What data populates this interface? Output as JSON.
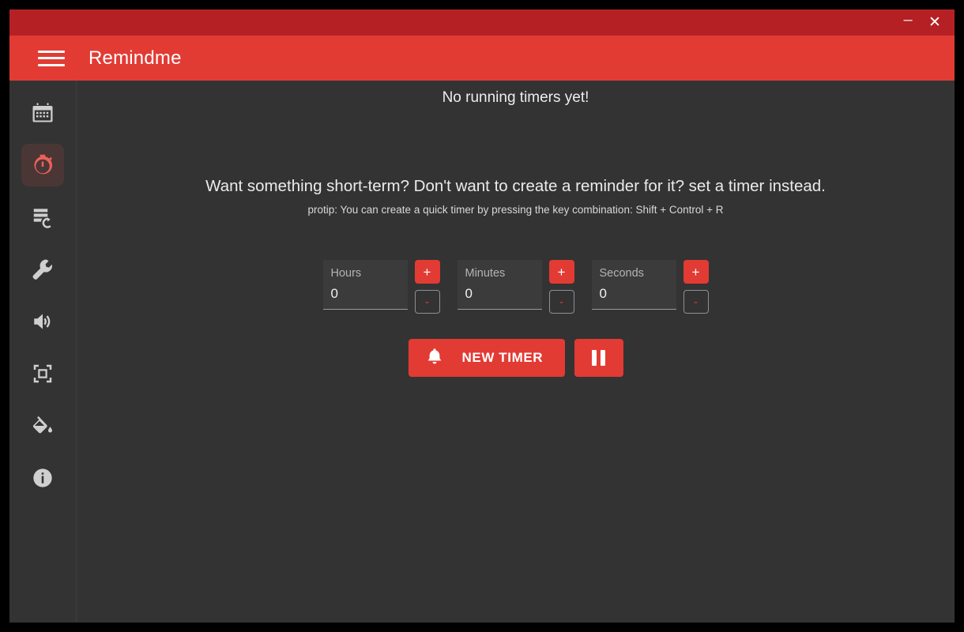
{
  "window": {
    "titlebar": {
      "minimize_label": "–",
      "close_label": "✕"
    },
    "header": {
      "title": "Remindme",
      "menu_icon": "hamburger-icon"
    },
    "colors": {
      "titlebar_red": "#b52025",
      "header_red": "#e23b34",
      "accent_red": "#e23b34",
      "active_icon_red": "#ec6158",
      "background_dark": "#333333",
      "active_item_bg": "#4b3636"
    }
  },
  "sidebar": {
    "items": [
      {
        "name": "calendar",
        "icon": "calendar-icon",
        "active": false
      },
      {
        "name": "timers",
        "icon": "stopwatch-icon",
        "active": true
      },
      {
        "name": "history",
        "icon": "history-icon",
        "active": false
      },
      {
        "name": "settings",
        "icon": "wrench-icon",
        "active": false
      },
      {
        "name": "sound",
        "icon": "volume-icon",
        "active": false
      },
      {
        "name": "screenshot",
        "icon": "frame-icon",
        "active": false
      },
      {
        "name": "theme",
        "icon": "paint-bucket-icon",
        "active": false
      },
      {
        "name": "about",
        "icon": "info-icon",
        "active": false
      }
    ]
  },
  "main": {
    "status": "No running timers yet!",
    "pitch": "Want something short-term? Don't want to create a reminder for it? set a timer instead.",
    "protip": "protip: You can create a quick timer by pressing the key combination: Shift + Control + R",
    "fields": [
      {
        "label": "Hours",
        "value": "0",
        "increment_label": "+",
        "decrement_label": "-"
      },
      {
        "label": "Minutes",
        "value": "0",
        "increment_label": "+",
        "decrement_label": "-"
      },
      {
        "label": "Seconds",
        "value": "0",
        "increment_label": "+",
        "decrement_label": "-"
      }
    ],
    "actions": {
      "new_timer_label": "NEW TIMER",
      "new_timer_icon": "bell-icon",
      "pause_icon": "pause-icon"
    }
  }
}
